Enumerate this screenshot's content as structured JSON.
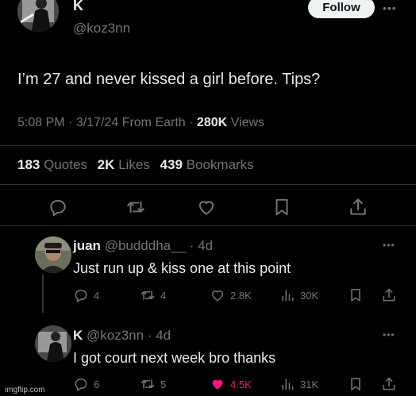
{
  "tweet": {
    "name": "K",
    "handle": "@koz3nn",
    "follow_label": "Follow",
    "text": "I’m 27 and never kissed a girl before. Tips?",
    "time": "5:08 PM",
    "date": "3/17/24",
    "source": "From Earth",
    "views_count": "280K",
    "views_label": "Views",
    "quotes_count": "183",
    "quotes_label": "Quotes",
    "likes_count": "2K",
    "likes_label": "Likes",
    "bookmarks_count": "439",
    "bookmarks_label": "Bookmarks",
    "icons": [
      "reply-icon",
      "retweet-icon",
      "like-icon",
      "bookmark-icon",
      "share-icon"
    ]
  },
  "replies": [
    {
      "name": "juan",
      "handle": "@budddha__",
      "age": "4d",
      "text": "Just run up & kiss one at this point",
      "replies_count": "4",
      "retweets_count": "4",
      "likes_count": "2.8K",
      "views_count": "30K",
      "liked": false
    },
    {
      "name": "K",
      "handle": "@koz3nn",
      "age": "4d",
      "text": "I got court next week bro thanks",
      "replies_count": "6",
      "retweets_count": "5",
      "likes_count": "4.5K",
      "views_count": "31K",
      "liked": true
    }
  ],
  "watermark": "imgflip.com",
  "colors": {
    "background": "#000000",
    "text": "#e7e9ea",
    "muted": "#71767b",
    "divider": "#2f3336",
    "like_active": "#f91880"
  }
}
